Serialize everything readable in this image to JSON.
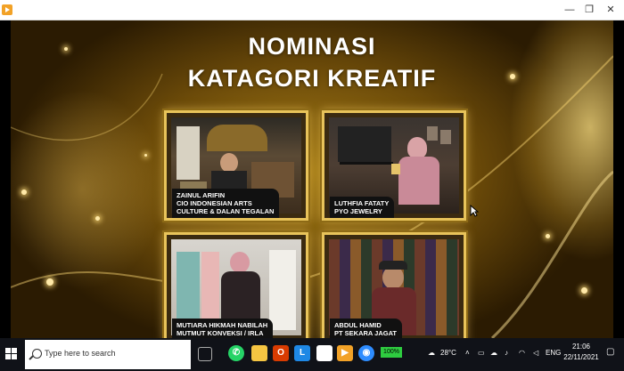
{
  "window": {
    "minimize_glyph": "—",
    "maximize_glyph": "❐",
    "close_glyph": "✕"
  },
  "slide": {
    "title_line1": "NOMINASI",
    "title_line2": "KATAGORI KREATIF",
    "nominees": [
      {
        "line1": "ZAINUL ARIFIN",
        "line2": "CIO INDONESIAN ARTS",
        "line3": "CULTURE & DALAN TEGALAN"
      },
      {
        "line1": "LUTHFIA FATATY",
        "line2": "PYO JEWELRY",
        "line3": ""
      },
      {
        "line1": "MUTIARA HIKMAH NABILAH",
        "line2": "MUTMUT KONVEKSI / IRLA",
        "line3": ""
      },
      {
        "line1": "ABDUL HAMID",
        "line2": "PT SEKARA JAGAT",
        "line3": ""
      }
    ]
  },
  "taskbar": {
    "search_placeholder": "Type here to search",
    "battery_label": "100%",
    "weather": "28°C",
    "language": "ENG",
    "time": "21:06",
    "date": "22/11/2021"
  },
  "colors": {
    "accent_gold": "#e8c35a",
    "taskbar": "#101218"
  }
}
